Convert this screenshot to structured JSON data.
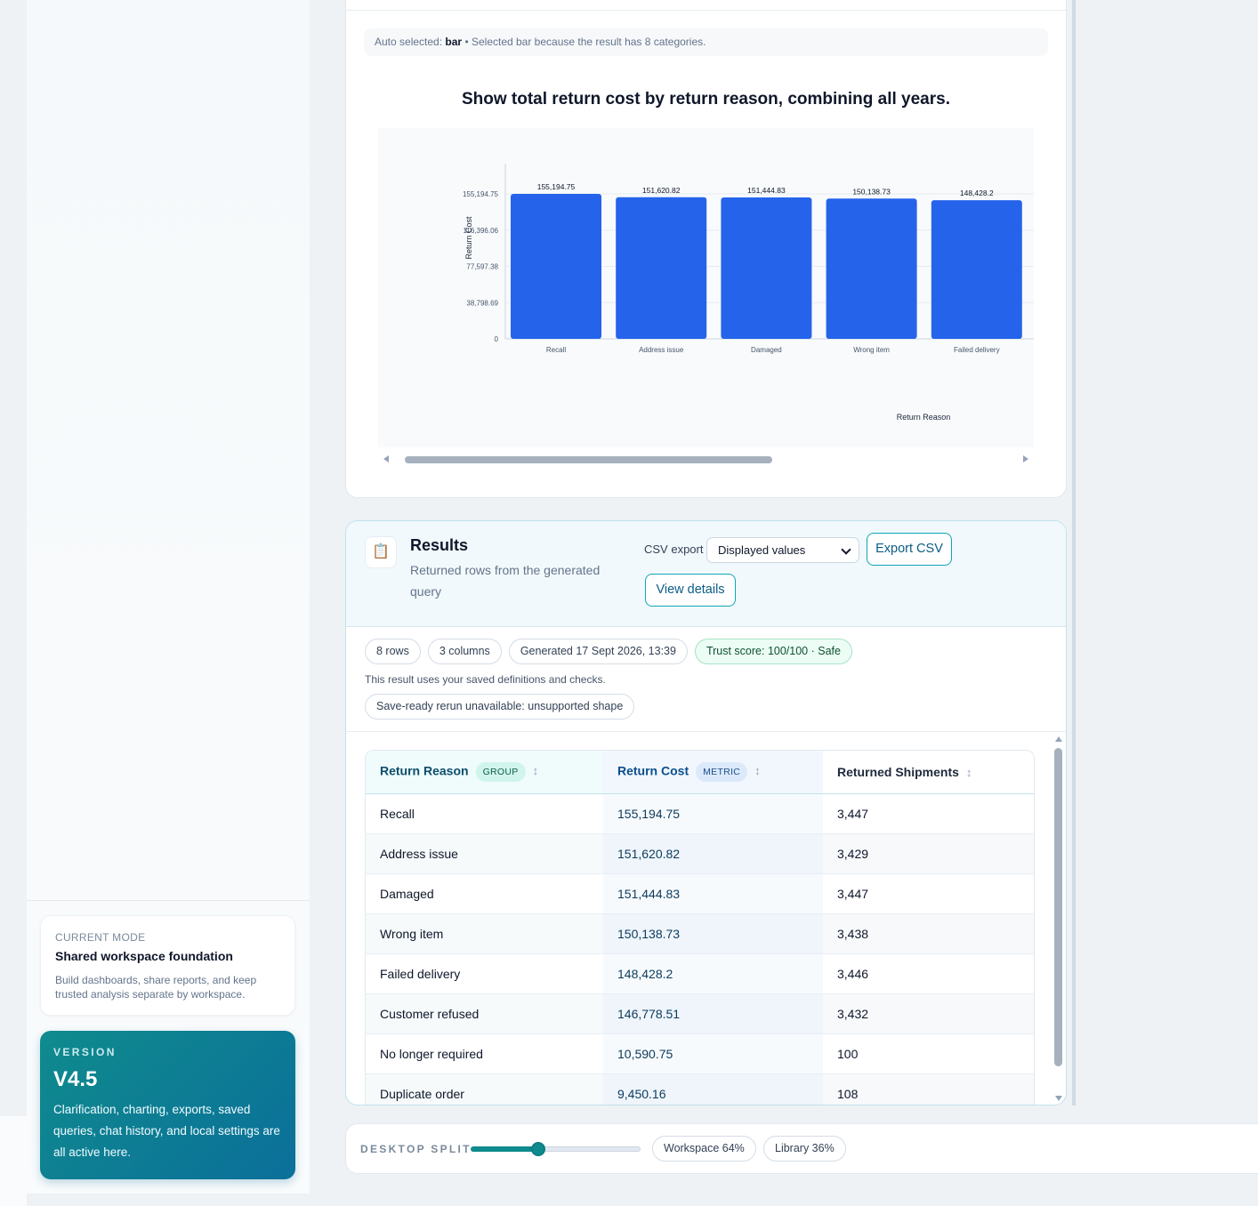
{
  "sidebar": {
    "mode": {
      "eyebrow": "CURRENT MODE",
      "title": "Shared workspace foundation",
      "description": "Build dashboards, share reports, and keep trusted analysis separate by workspace."
    },
    "version": {
      "eyebrow": "VERSION",
      "value": "V4.5",
      "description": "Clarification, charting, exports, saved queries, chat history, and local settings are all active here."
    }
  },
  "chart_card": {
    "auto_prefix": "Auto selected:",
    "auto_type": "bar",
    "auto_reason": "• Selected bar because the result has 8 categories.",
    "chart_data": {
      "type": "bar",
      "title": "Show total return cost by return reason, combining all years.",
      "xlabel": "Return Reason",
      "ylabel": "Return Cost",
      "categories": [
        "Recall",
        "Address issue",
        "Damaged",
        "Wrong item",
        "Failed delivery"
      ],
      "values": [
        155194.75,
        151620.82,
        151444.83,
        150138.73,
        148428.2
      ],
      "value_labels": [
        "155,194.75",
        "151,620.82",
        "151,444.83",
        "150,138.73",
        "148,428.2"
      ],
      "yticks": [
        "0",
        "38,798.69",
        "77,597.38",
        "116,396.06",
        "155,194.75"
      ],
      "ytick_values": [
        0,
        38798.69,
        77597.38,
        116396.06,
        155194.75
      ],
      "ylim": [
        0,
        155194.75
      ],
      "grid": true,
      "bar_color": "#2563eb"
    }
  },
  "results": {
    "icon": "clipboard-icon",
    "title": "Results",
    "subtitle": "Returned rows from the generated query",
    "csv_label": "CSV export",
    "csv_selected": "Displayed values",
    "export_label": "Export CSV",
    "details_label": "View details",
    "pills": {
      "rows": "8 rows",
      "columns": "3 columns",
      "generated": "Generated 17 Sept 2026, 13:39",
      "trust": "Trust score: 100/100 · Safe"
    },
    "note": "This result uses your saved definitions and checks.",
    "rerun": "Save-ready rerun unavailable: unsupported shape",
    "table": {
      "headers": [
        {
          "label": "Return Reason",
          "tag": "GROUP"
        },
        {
          "label": "Return Cost",
          "tag": "METRIC"
        },
        {
          "label": "Returned Shipments",
          "tag": ""
        }
      ],
      "sort_glyph": "↕",
      "rows": [
        [
          "Recall",
          "155,194.75",
          "3,447"
        ],
        [
          "Address issue",
          "151,620.82",
          "3,429"
        ],
        [
          "Damaged",
          "151,444.83",
          "3,447"
        ],
        [
          "Wrong item",
          "150,138.73",
          "3,438"
        ],
        [
          "Failed delivery",
          "148,428.2",
          "3,446"
        ],
        [
          "Customer refused",
          "146,778.51",
          "3,432"
        ],
        [
          "No longer required",
          "10,590.75",
          "100"
        ],
        [
          "Duplicate order",
          "9,450.16",
          "108"
        ]
      ]
    }
  },
  "split": {
    "label": "DESKTOP SPLIT",
    "workspace": "Workspace 64%",
    "library": "Library 36%",
    "workspace_fraction": 0.4,
    "accent": "#0f8b8d"
  }
}
